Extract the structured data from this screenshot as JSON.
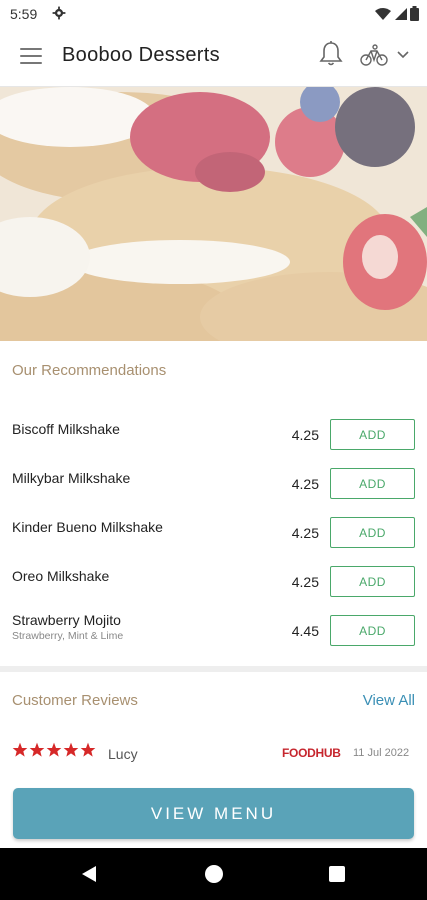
{
  "status": {
    "time": "5:59"
  },
  "header": {
    "title": "Booboo Desserts"
  },
  "recommendations": {
    "title": "Our Recommendations",
    "add_label": "ADD",
    "items": [
      {
        "name": "Biscoff Milkshake",
        "description": "",
        "price": "4.25"
      },
      {
        "name": "Milkybar Milkshake",
        "description": "",
        "price": "4.25"
      },
      {
        "name": "Kinder Bueno Milkshake",
        "description": "",
        "price": "4.25"
      },
      {
        "name": "Oreo Milkshake",
        "description": "",
        "price": "4.25"
      },
      {
        "name": "Strawberry Mojito",
        "description": "Strawberry, Mint & Lime",
        "price": "4.45"
      }
    ]
  },
  "reviews": {
    "title": "Customer Reviews",
    "view_all": "View All",
    "items": [
      {
        "rating": 5,
        "name": "Lucy",
        "source": "FOODHUB",
        "date": "11 Jul 2022"
      }
    ]
  },
  "cta": {
    "label": "VIEW MENU"
  },
  "colors": {
    "accent": "#5aa3b8",
    "add_green": "#4aa86a",
    "section_title": "#a89070",
    "link": "#3a8fb5",
    "star": "#d62828"
  }
}
